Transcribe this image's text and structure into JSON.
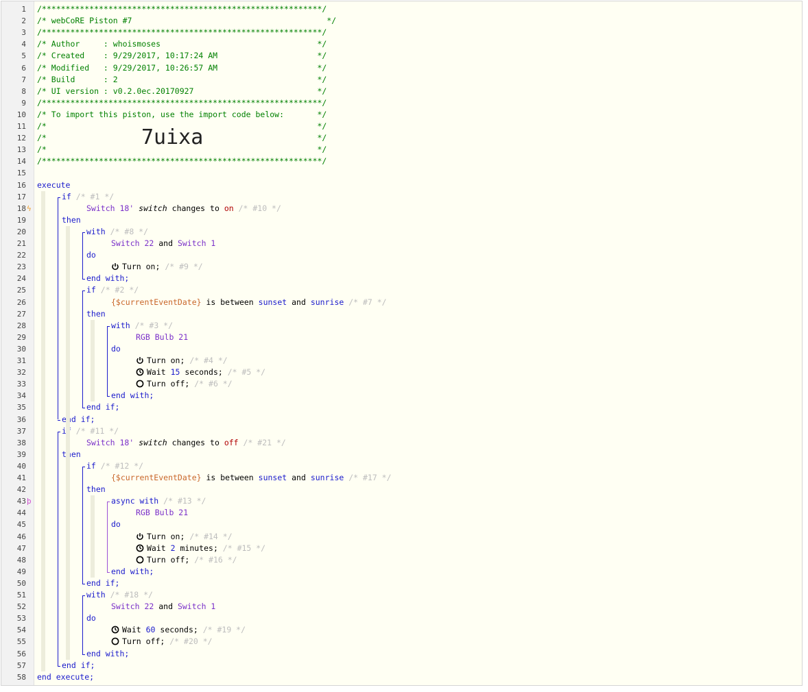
{
  "header": [
    "/***********************************************************/",
    "/* webCoRE Piston #7                                         */",
    "/***********************************************************/",
    "/* Author     : whoismoses                                 */",
    "/* Created    : 9/29/2017, 10:17:24 AM                     */",
    "/* Modified   : 9/29/2017, 10:26:57 AM                     */",
    "/* Build      : 2                                          */",
    "/* UI version : v0.2.0ec.20170927                          */",
    "/***********************************************************/",
    "/* To import this piston, use the import code below:       */",
    "/*                                                         */",
    "/*                                                         */",
    "/*                                                         */",
    "/***********************************************************/"
  ],
  "import_code": "7uixa",
  "line_numbers": [
    "1",
    "2",
    "3",
    "4",
    "5",
    "6",
    "7",
    "8",
    "9",
    "10",
    "11",
    "12",
    "13",
    "14",
    "15",
    "16",
    "17",
    "18",
    "19",
    "20",
    "21",
    "22",
    "23",
    "24",
    "25",
    "26",
    "27",
    "28",
    "29",
    "30",
    "31",
    "32",
    "33",
    "34",
    "35",
    "36",
    "37",
    "38",
    "39",
    "40",
    "41",
    "42",
    "43",
    "44",
    "45",
    "46",
    "47",
    "48",
    "49",
    "50",
    "51",
    "52",
    "53",
    "54",
    "55",
    "56",
    "57",
    "58"
  ],
  "code": {
    "l16": "execute",
    "l17_kw": "if",
    "l17_c": "/* #1 */",
    "l18_dev": "Switch 18'",
    "l18_attr": "switch",
    "l18_txt": "changes to",
    "l18_val": "on",
    "l18_c": "/* #10 */",
    "l19": "then",
    "l20_kw": "with",
    "l20_c": "/* #8 */",
    "l21_d1": "Switch 22",
    "l21_and": "and",
    "l21_d2": "Switch 1",
    "l22": "do",
    "l23_txt": "Turn on;",
    "l23_c": "/* #9 */",
    "l24": "end with;",
    "l25_kw": "if",
    "l25_c": "/* #2 */",
    "l26_var": "{$currentEventDate}",
    "l26_txt": "is between",
    "l26_a": "sunset",
    "l26_and": "and",
    "l26_b": "sunrise",
    "l26_c": "/* #7 */",
    "l27": "then",
    "l28_kw": "with",
    "l28_c": "/* #3 */",
    "l29_dev": "RGB Bulb 21",
    "l30": "do",
    "l31_txt": "Turn on;",
    "l31_c": "/* #4 */",
    "l32_a": "Wait",
    "l32_n": "15",
    "l32_b": "seconds;",
    "l32_c": "/* #5 */",
    "l33_txt": "Turn off;",
    "l33_c": "/* #6 */",
    "l34": "end with;",
    "l35": "end if;",
    "l36": "end if;",
    "l37_kw": "if",
    "l37_c": "/* #11 */",
    "l38_dev": "Switch 18'",
    "l38_attr": "switch",
    "l38_txt": "changes to",
    "l38_val": "off",
    "l38_c": "/* #21 */",
    "l39": "then",
    "l40_kw": "if",
    "l40_c": "/* #12 */",
    "l41_var": "{$currentEventDate}",
    "l41_txt": "is between",
    "l41_a": "sunset",
    "l41_and": "and",
    "l41_b": "sunrise",
    "l41_c": "/* #17 */",
    "l42": "then",
    "l43_kw": "async with",
    "l43_c": "/* #13 */",
    "l44_dev": "RGB Bulb 21",
    "l45": "do",
    "l46_txt": "Turn on;",
    "l46_c": "/* #14 */",
    "l47_a": "Wait",
    "l47_n": "2",
    "l47_b": "minutes;",
    "l47_c": "/* #15 */",
    "l48_txt": "Turn off;",
    "l48_c": "/* #16 */",
    "l49": "end with;",
    "l50": "end if;",
    "l51_kw": "with",
    "l51_c": "/* #18 */",
    "l52_d1": "Switch 22",
    "l52_and": "and",
    "l52_d2": "Switch 1",
    "l53": "do",
    "l54_a": "Wait",
    "l54_n": "60",
    "l54_b": "seconds;",
    "l54_c": "/* #19 */",
    "l55_txt": "Turn off;",
    "l55_c": "/* #20 */",
    "l56": "end with;",
    "l57": "end if;",
    "l58": "end execute;"
  },
  "markers": {
    "trigger_icon": "lightning-icon",
    "async_icon": "parallel-icon"
  },
  "colors": {
    "keyword": "#1a1acc",
    "device": "#7a2fc9",
    "variable": "#c9672b",
    "comment": "#008000",
    "value": "#b00000"
  }
}
